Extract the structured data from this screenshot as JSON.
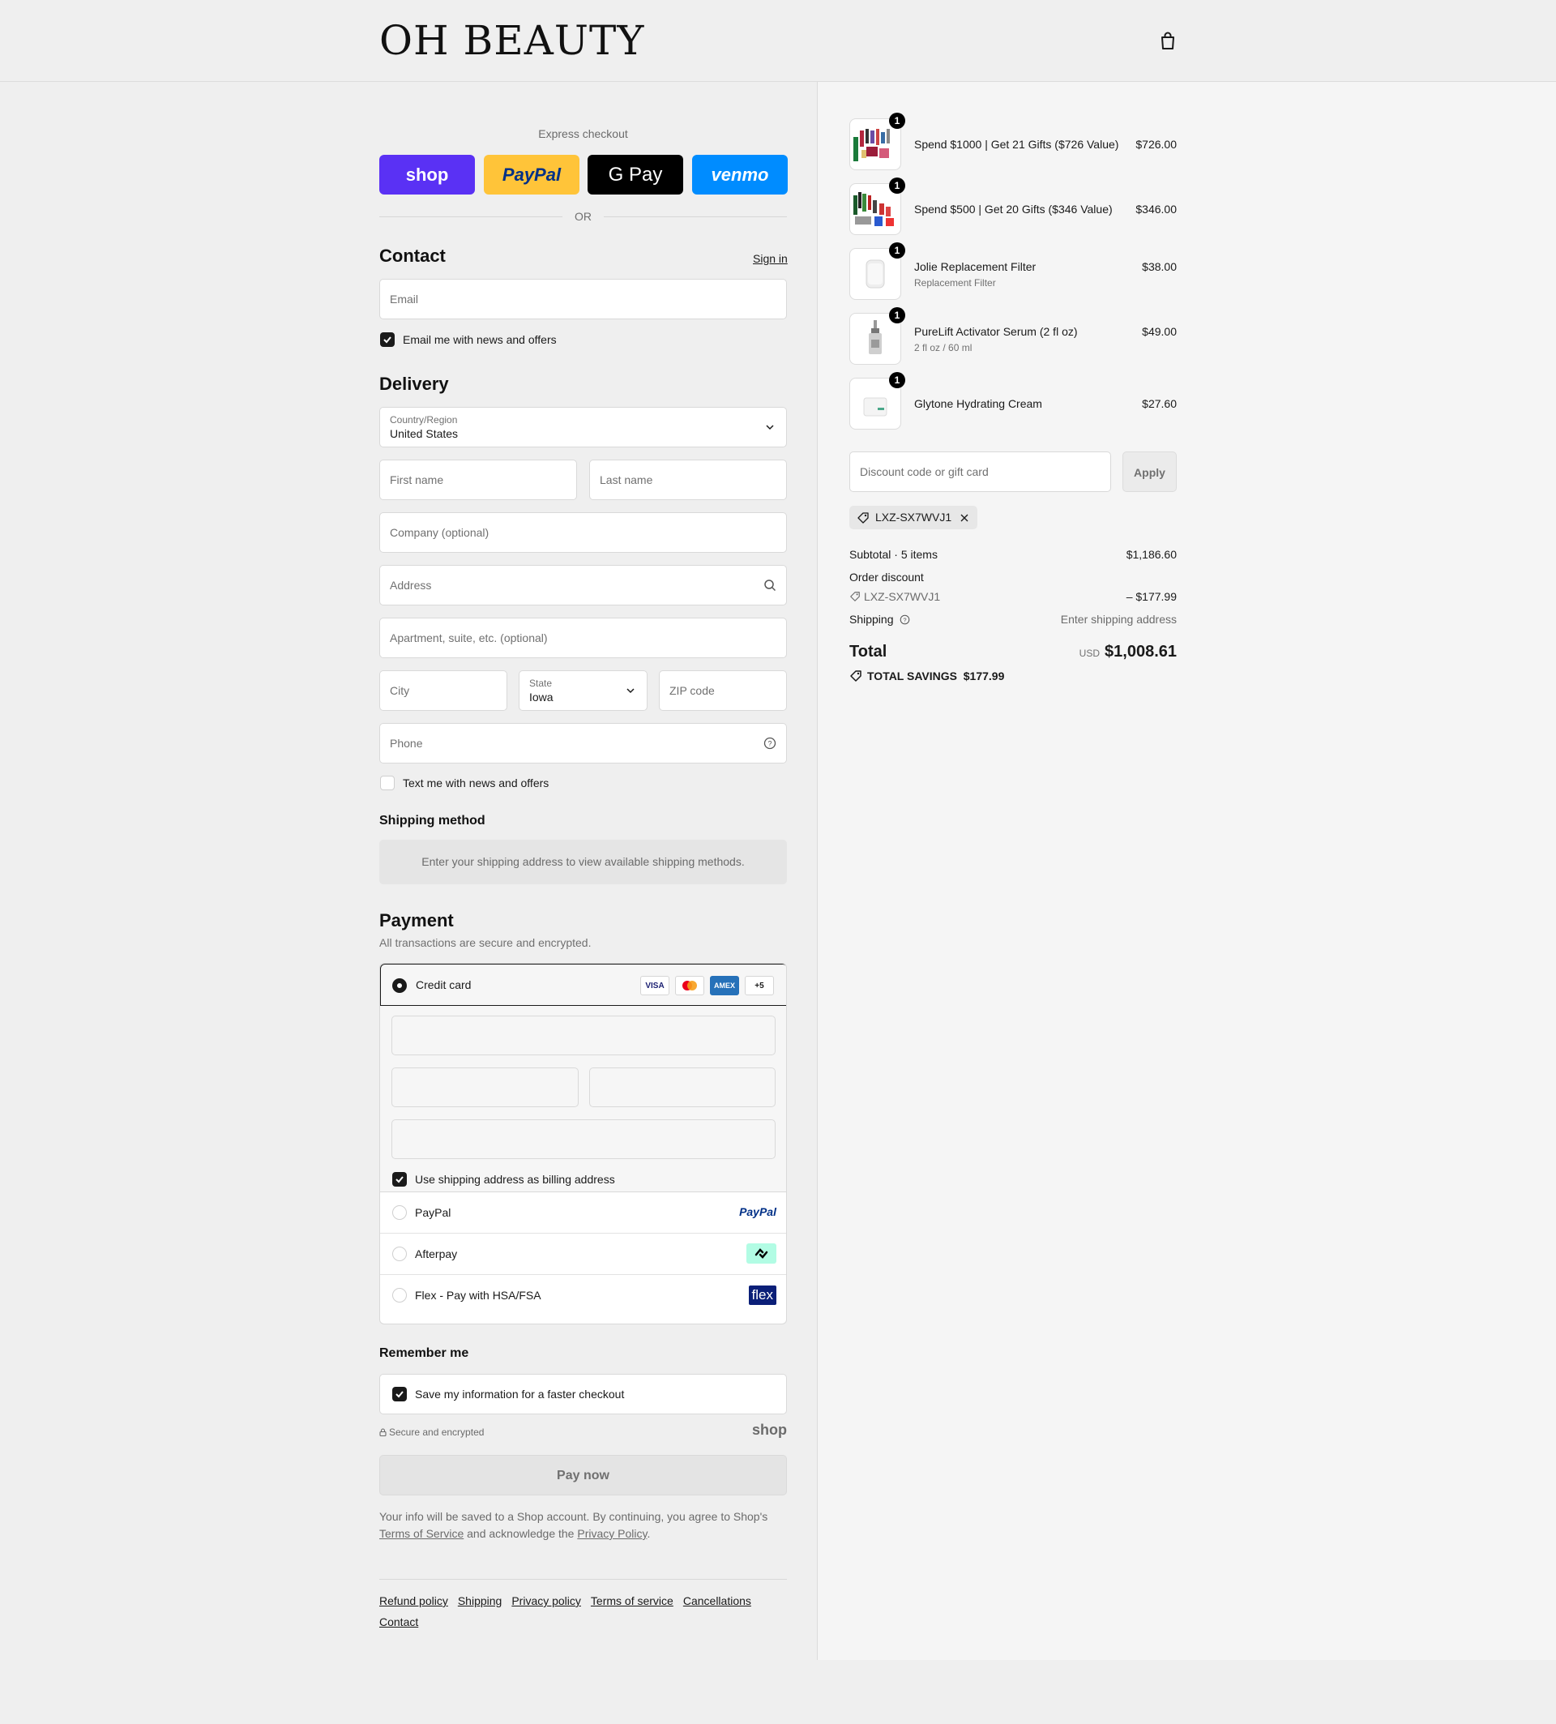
{
  "brand": {
    "logo_text": "OH BEAUTY"
  },
  "express": {
    "label": "Express checkout",
    "buttons": [
      {
        "label": "shop",
        "bg": "#5a31f4",
        "fg": "#ffffff"
      },
      {
        "label": "PayPal",
        "bg": "#ffc439",
        "fg": "#003087"
      },
      {
        "label": "G Pay",
        "bg": "#000000",
        "fg": "#ffffff"
      },
      {
        "label": "venmo",
        "bg": "#008cff",
        "fg": "#ffffff"
      }
    ],
    "or_text": "OR"
  },
  "contact": {
    "title": "Contact",
    "sign_in": "Sign in",
    "email_placeholder": "Email",
    "newsletter_label": "Email me with news and offers",
    "newsletter_checked": true
  },
  "delivery": {
    "title": "Delivery",
    "country_label": "Country/Region",
    "country_value": "United States",
    "first_name_placeholder": "First name",
    "last_name_placeholder": "Last name",
    "company_placeholder": "Company (optional)",
    "address_placeholder": "Address",
    "apartment_placeholder": "Apartment, suite, etc. (optional)",
    "city_placeholder": "City",
    "state_label": "State",
    "state_value": "Iowa",
    "zip_placeholder": "ZIP code",
    "phone_placeholder": "Phone",
    "sms_label": "Text me with news and offers",
    "sms_checked": false
  },
  "shipping_method": {
    "title": "Shipping method",
    "message": "Enter your shipping address to view available shipping methods."
  },
  "payment": {
    "title": "Payment",
    "subtitle": "All transactions are secure and encrypted.",
    "credit_card_label": "Credit card",
    "card_badges": [
      "VISA",
      "MC",
      "AMEX",
      "+5"
    ],
    "billing_label": "Use shipping address as billing address",
    "billing_checked": true,
    "methods": [
      {
        "label": "PayPal",
        "badge": "PayPal"
      },
      {
        "label": "Afterpay",
        "badge": "afterpay"
      },
      {
        "label": "Flex - Pay with HSA/FSA",
        "badge": "flex"
      }
    ]
  },
  "remember": {
    "title": "Remember me",
    "save_label": "Save my information for a faster checkout",
    "save_checked": true,
    "secure_text": "Secure and encrypted",
    "shop_brand": "shop"
  },
  "pay_now": "Pay now",
  "legal": {
    "prefix": "Your info will be saved to a Shop account. By continuing, you agree to Shop's",
    "terms": "Terms of Service",
    "middle": "and acknowledge the",
    "privacy": "Privacy Policy",
    "suffix": "."
  },
  "footer_links": [
    "Refund policy",
    "Shipping",
    "Privacy policy",
    "Terms of service",
    "Cancellations",
    "Contact"
  ],
  "order": {
    "items": [
      {
        "name": "Spend $1000 | Get 21 Gifts ($726 Value)",
        "sub": "",
        "price": "$726.00",
        "qty": "1"
      },
      {
        "name": "Spend $500 | Get 20 Gifts ($346 Value)",
        "sub": "",
        "price": "$346.00",
        "qty": "1"
      },
      {
        "name": "Jolie Replacement Filter",
        "sub": "Replacement Filter",
        "price": "$38.00",
        "qty": "1"
      },
      {
        "name": "PureLift Activator Serum (2 fl oz)",
        "sub": "2 fl oz / 60 ml",
        "price": "$49.00",
        "qty": "1"
      },
      {
        "name": "Glytone Hydrating Cream",
        "sub": "",
        "price": "$27.60",
        "qty": "1"
      }
    ],
    "discount_placeholder": "Discount code or gift card",
    "apply_label": "Apply",
    "code": "LXZ-SX7WVJ1",
    "subtotal_label": "Subtotal · 5 items",
    "subtotal_value": "$1,186.60",
    "order_discount_label": "Order discount",
    "discount_code": "LXZ-SX7WVJ1",
    "discount_value": "– $177.99",
    "shipping_label": "Shipping",
    "shipping_value": "Enter shipping address",
    "total_label": "Total",
    "currency": "USD",
    "total_value": "$1,008.61",
    "savings_label": "TOTAL SAVINGS",
    "savings_value": "$177.99"
  }
}
